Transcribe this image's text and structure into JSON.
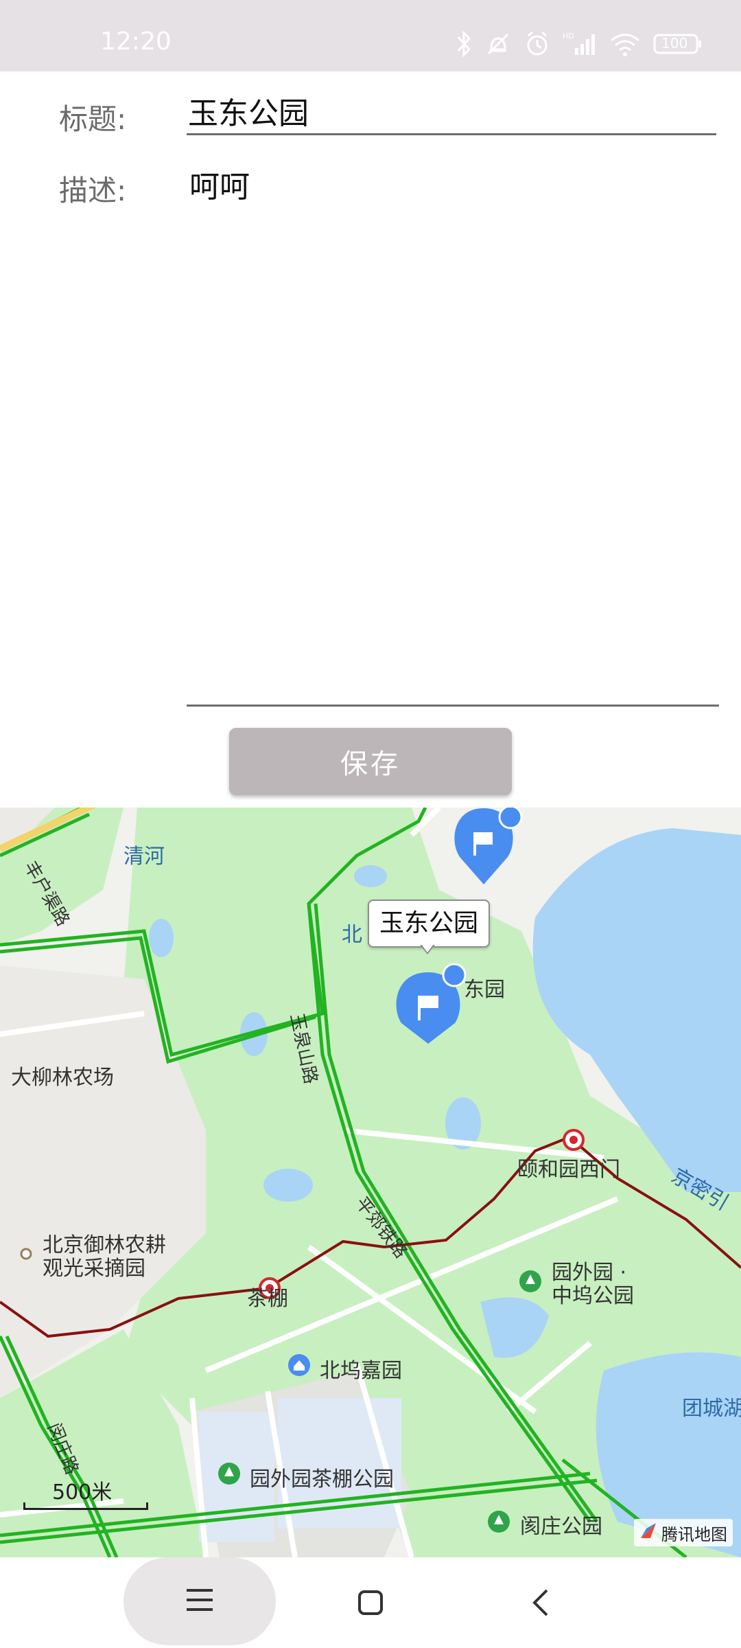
{
  "status_bar": {
    "time": "12:20",
    "battery": "100",
    "icons": [
      "bluetooth-icon",
      "mute-icon",
      "alarm-icon",
      "hd-signal-icon",
      "wifi-icon",
      "battery-icon"
    ]
  },
  "form": {
    "title_label": "标题:",
    "title_value": "玉东公园",
    "description_label": "描述:",
    "description_value": "呵呵",
    "save_label": "保存"
  },
  "map": {
    "info_window_title": "玉东公园",
    "labels": {
      "qinghe": "清河",
      "fengkuqu": "丰户渠路",
      "dashenglin": "大柳林农场",
      "beijing_yulin": "北京御林农耕",
      "beijing_yulin2": "观光采摘园",
      "chapeng": "茶棚",
      "beiwu_jiayuan": "北坞嘉园",
      "yuanwai_chapeng": "园外园茶棚公园",
      "yanzhuang": "阂庄公园",
      "yiheyuan_ximen": "颐和园西门",
      "yuanwaiyuan": "园外园 ·",
      "zhongwu": "中坞公园",
      "tuancheng": "团城湖",
      "jingmi": "京密引",
      "yuquan": "玉泉山路",
      "pingjie": "平郊铁路",
      "dongyuan": "东园",
      "bei": "北",
      "mincun": "闵庄路"
    },
    "scale_label": "500米",
    "attribution": "腾讯地图",
    "colors": {
      "park": "#c8efc0",
      "water": "#a9d4f5",
      "road": "#ffffff",
      "green_route": "#22b322",
      "metro": "#8a1010",
      "marker": "#4a8df0"
    }
  },
  "nav_bar": {
    "icons": [
      "menu-icon",
      "home-square-icon",
      "back-chevron-icon"
    ]
  }
}
